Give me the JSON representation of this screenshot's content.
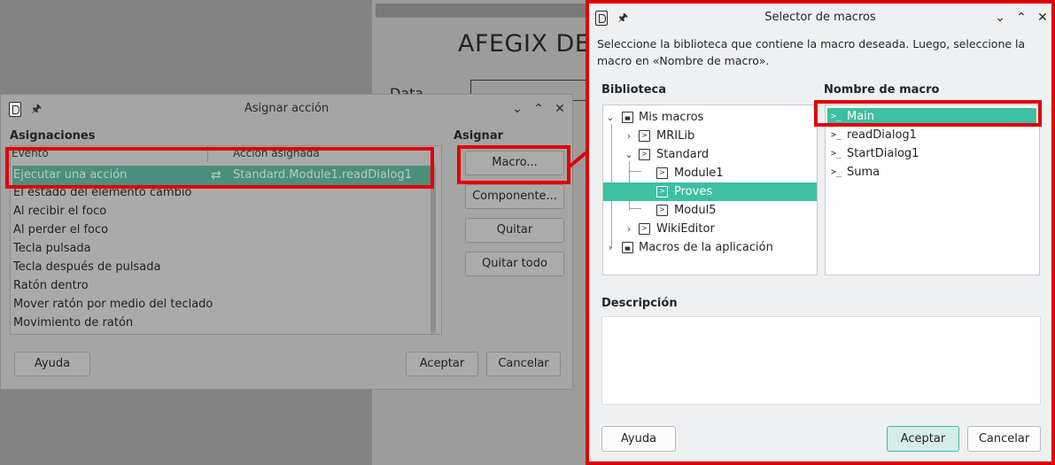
{
  "background_document": {
    "title": "AFEGIX DES",
    "field_label": "Data"
  },
  "assign_action": {
    "window_title": "Asignar acción",
    "section_assignments": "Asignaciones",
    "section_assign": "Asignar",
    "columns": [
      "Evento",
      "Acción asignada"
    ],
    "selected_event": {
      "event": "Ejecutar una acción",
      "action": "Standard.Module1.readDialog1"
    },
    "events": [
      "El estado del elemento cambió",
      "Al recibir el foco",
      "Al perder el foco",
      "Tecla pulsada",
      "Tecla después de pulsada",
      "Ratón dentro",
      "Mover ratón por medio del teclado",
      "Movimiento de ratón"
    ],
    "buttons": {
      "macro": "Macro...",
      "component": "Componente...",
      "remove": "Quitar",
      "remove_all": "Quitar todo",
      "help": "Ayuda",
      "ok": "Aceptar",
      "cancel": "Cancelar"
    }
  },
  "macro_selector": {
    "window_title": "Selector de macros",
    "description": "Seleccione la biblioteca que contiene la macro deseada. Luego, seleccione la macro en «Nombre de macro».",
    "library_label": "Biblioteca",
    "macro_name_label": "Nombre de macro",
    "description_label": "Descripción",
    "library_tree": {
      "my_macros": "Mis macros",
      "mrilib": "MRILib",
      "standard": "Standard",
      "module1": "Module1",
      "proves": "Proves",
      "modul5": "Modul5",
      "wikieditor": "WikiEditor",
      "app_macros": "Macros de la aplicación"
    },
    "macros": [
      "Main",
      "readDialog1",
      "StartDialog1",
      "Suma"
    ],
    "selected_macro": "Main",
    "selected_library": "Proves",
    "buttons": {
      "help": "Ayuda",
      "ok": "Aceptar",
      "cancel": "Cancelar"
    }
  },
  "colors": {
    "accent": "#3dbfa3",
    "highlight": "#e00000"
  }
}
